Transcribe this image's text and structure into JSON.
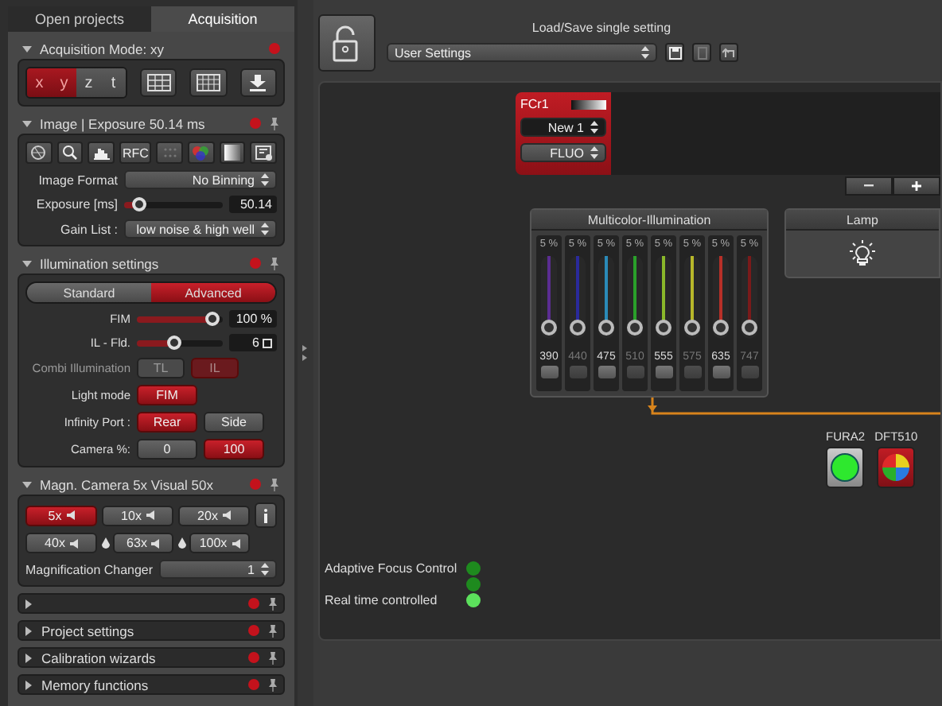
{
  "tabs": [
    {
      "label": "Open projects",
      "selected": false
    },
    {
      "label": "Acquisition",
      "selected": true
    }
  ],
  "sections": [
    {
      "kind": "mode",
      "title": "Acquisition Mode: xy",
      "expanded": true,
      "axes": [
        {
          "label": "x",
          "selected": true
        },
        {
          "label": "y",
          "selected": true
        },
        {
          "label": "z",
          "selected": false
        },
        {
          "label": "t",
          "selected": false
        }
      ]
    },
    {
      "kind": "image",
      "title": "Image | Exposure 50.14 ms",
      "expanded": true,
      "tool_label": "RFC",
      "format": {
        "label": "Image Format",
        "value": "No Binning"
      },
      "exposure": {
        "label": "Exposure [ms]",
        "level": 0.1,
        "value": "50.14"
      },
      "gain": {
        "label": "Gain List :",
        "value": "low noise & high well"
      }
    },
    {
      "kind": "illumination",
      "title": "Illumination settings",
      "expanded": true,
      "modes": [
        {
          "label": "Standard",
          "selected": false
        },
        {
          "label": "Advanced",
          "selected": true
        }
      ],
      "sliders": [
        {
          "label": "FIM",
          "level": 0.95,
          "value": "100 %"
        },
        {
          "label": "IL - Fld.",
          "level": 0.42,
          "value": "6"
        }
      ],
      "rows": [
        {
          "label": "Combi Illumination",
          "disabled": true,
          "buttons": [
            {
              "label": "TL",
              "on": false
            },
            {
              "label": "IL",
              "on": true
            }
          ]
        },
        {
          "label": "Light mode",
          "disabled": false,
          "buttons": [
            {
              "label": "FIM",
              "on": true
            }
          ]
        },
        {
          "label": "Infinity Port :",
          "disabled": false,
          "buttons": [
            {
              "label": "Rear",
              "on": true
            },
            {
              "label": "Side",
              "on": false
            }
          ]
        },
        {
          "label": "Camera %:",
          "disabled": false,
          "buttons": [
            {
              "label": "0",
              "on": false
            },
            {
              "label": "100",
              "on": true
            }
          ]
        }
      ]
    },
    {
      "kind": "magnification",
      "title": "Magn.  Camera 5x Visual 50x",
      "expanded": true,
      "objectives": [
        {
          "label": "5x",
          "selected": true,
          "immersion": false
        },
        {
          "label": "10x",
          "selected": false,
          "immersion": false
        },
        {
          "label": "20x",
          "selected": false,
          "immersion": false
        },
        {
          "label": "40x",
          "selected": false,
          "immersion": false
        },
        {
          "label": "63x",
          "selected": false,
          "immersion": true
        },
        {
          "label": "100x",
          "selected": false,
          "immersion": true
        }
      ],
      "changer": {
        "label": "Magnification Changer",
        "value": "1"
      }
    },
    {
      "kind": "collapsed",
      "expanded": false
    },
    {
      "kind": "collapsed",
      "title": "Project settings",
      "expanded": false
    },
    {
      "kind": "collapsed",
      "title": "Calibration wizards",
      "expanded": false
    },
    {
      "kind": "collapsed",
      "title": "Memory functions",
      "expanded": false
    }
  ],
  "settings_bar": {
    "title": "Load/Save single setting",
    "preset": "User Settings"
  },
  "filter_cube": {
    "name": "FCr1",
    "slot": "New 1",
    "mode": "FLUO"
  },
  "multicolor": {
    "title": "Multicolor-Illumination",
    "channels": [
      {
        "wavelength": "390",
        "reading": "5 %",
        "level": 0.05,
        "color": "#5b2d91",
        "on": true
      },
      {
        "wavelength": "440",
        "reading": "5 %",
        "level": 0.05,
        "color": "#2a2a9c",
        "on": false
      },
      {
        "wavelength": "475",
        "reading": "5 %",
        "level": 0.05,
        "color": "#2a8ab8",
        "on": true
      },
      {
        "wavelength": "510",
        "reading": "5 %",
        "level": 0.05,
        "color": "#2aa02a",
        "on": false
      },
      {
        "wavelength": "555",
        "reading": "5 %",
        "level": 0.05,
        "color": "#8ab82a",
        "on": true
      },
      {
        "wavelength": "575",
        "reading": "5 %",
        "level": 0.05,
        "color": "#b8b82a",
        "on": false
      },
      {
        "wavelength": "635",
        "reading": "5 %",
        "level": 0.05,
        "color": "#b83028",
        "on": true
      },
      {
        "wavelength": "747",
        "reading": "5 %",
        "level": 0.05,
        "color": "#7a1a1a",
        "on": false
      }
    ]
  },
  "lamp": {
    "title": "Lamp"
  },
  "fluorophores": [
    {
      "name": "FURA2",
      "kind": "single"
    },
    {
      "name": "DFT510",
      "kind": "multi"
    }
  ],
  "status": [
    {
      "label": "Adaptive Focus Control",
      "color": "#1e8a1e"
    },
    {
      "color": "#1e8a1e"
    },
    {
      "label": "Real time controlled",
      "color": "#5ce05c"
    }
  ]
}
